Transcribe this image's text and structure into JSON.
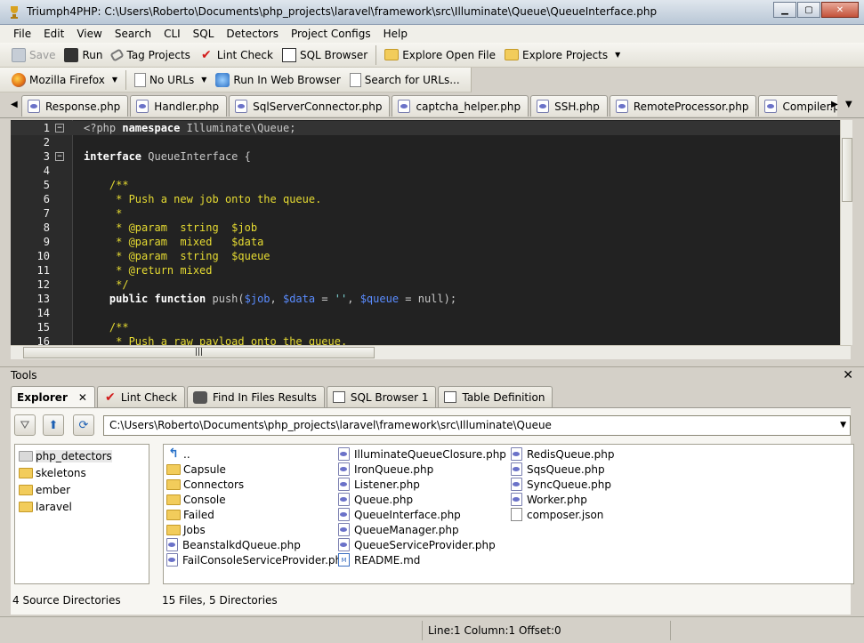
{
  "window": {
    "title": "Triumph4PHP: C:\\Users\\Roberto\\Documents\\php_projects\\laravel\\framework\\src\\Illuminate\\Queue\\QueueInterface.php"
  },
  "menu": [
    "File",
    "Edit",
    "View",
    "Search",
    "CLI",
    "SQL",
    "Detectors",
    "Project Configs",
    "Help"
  ],
  "toolbar1": {
    "save": "Save",
    "run": "Run",
    "tag_projects": "Tag Projects",
    "lint_check": "Lint Check",
    "sql_browser": "SQL Browser",
    "explore_open_file": "Explore Open File",
    "explore_projects": "Explore Projects"
  },
  "toolbar2": {
    "browser": "Mozilla Firefox",
    "urls": "No URLs",
    "run_in_browser": "Run In Web Browser",
    "search_urls": "Search for URLs..."
  },
  "editor_tabs": [
    "Response.php",
    "Handler.php",
    "SqlServerConnector.php",
    "captcha_helper.php",
    "SSH.php",
    "RemoteProcessor.php",
    "Compiler.php",
    ""
  ],
  "editor": {
    "lines": [
      {
        "n": "1",
        "fold": "−",
        "parts": [
          {
            "t": "<?php ",
            "c": "cls"
          },
          {
            "t": "namespace ",
            "c": "kw"
          },
          {
            "t": "Illuminate\\Queue;",
            "c": "cls"
          }
        ]
      },
      {
        "n": "2",
        "fold": "",
        "parts": []
      },
      {
        "n": "3",
        "fold": "−",
        "parts": [
          {
            "t": "interface ",
            "c": "kw"
          },
          {
            "t": "QueueInterface {",
            "c": "cls"
          }
        ]
      },
      {
        "n": "4",
        "fold": "",
        "parts": []
      },
      {
        "n": "5",
        "fold": "",
        "parts": [
          {
            "t": "    /**",
            "c": "cm"
          }
        ]
      },
      {
        "n": "6",
        "fold": "",
        "parts": [
          {
            "t": "     * Push a new job onto the queue.",
            "c": "cm"
          }
        ]
      },
      {
        "n": "7",
        "fold": "",
        "parts": [
          {
            "t": "     *",
            "c": "cm"
          }
        ]
      },
      {
        "n": "8",
        "fold": "",
        "parts": [
          {
            "t": "     * @param  string  $job",
            "c": "cm"
          }
        ]
      },
      {
        "n": "9",
        "fold": "",
        "parts": [
          {
            "t": "     * @param  mixed   $data",
            "c": "cm"
          }
        ]
      },
      {
        "n": "10",
        "fold": "",
        "parts": [
          {
            "t": "     * @param  string  $queue",
            "c": "cm"
          }
        ]
      },
      {
        "n": "11",
        "fold": "",
        "parts": [
          {
            "t": "     * @return mixed",
            "c": "cm"
          }
        ]
      },
      {
        "n": "12",
        "fold": "",
        "parts": [
          {
            "t": "     */",
            "c": "cm"
          }
        ]
      },
      {
        "n": "13",
        "fold": "",
        "parts": [
          {
            "t": "    public function ",
            "c": "kw"
          },
          {
            "t": "push(",
            "c": "cls"
          },
          {
            "t": "$job",
            "c": "var"
          },
          {
            "t": ", ",
            "c": "cls"
          },
          {
            "t": "$data",
            "c": "var"
          },
          {
            "t": " = ",
            "c": "cls"
          },
          {
            "t": "''",
            "c": "str"
          },
          {
            "t": ", ",
            "c": "cls"
          },
          {
            "t": "$queue",
            "c": "var"
          },
          {
            "t": " = null);",
            "c": "cls"
          }
        ]
      },
      {
        "n": "14",
        "fold": "",
        "parts": []
      },
      {
        "n": "15",
        "fold": "",
        "parts": [
          {
            "t": "    /**",
            "c": "cm"
          }
        ]
      },
      {
        "n": "16",
        "fold": "",
        "parts": [
          {
            "t": "     * Push a raw payload onto the queue.",
            "c": "cm"
          }
        ]
      }
    ]
  },
  "tools": {
    "header": "Tools",
    "close": "✕",
    "tabs": [
      "Explorer",
      "Lint Check",
      "Find In Files Results",
      "SQL Browser 1",
      "Table Definition"
    ]
  },
  "explorer": {
    "path": "C:\\Users\\Roberto\\Documents\\php_projects\\laravel\\framework\\src\\Illuminate\\Queue",
    "source_dirs": [
      "php_detectors",
      "skeletons",
      "ember",
      "laravel"
    ],
    "files_col1": [
      {
        "name": "..",
        "kind": "up"
      },
      {
        "name": "Capsule",
        "kind": "folder"
      },
      {
        "name": "Connectors",
        "kind": "folder"
      },
      {
        "name": "Console",
        "kind": "folder"
      },
      {
        "name": "Failed",
        "kind": "folder"
      },
      {
        "name": "Jobs",
        "kind": "folder"
      },
      {
        "name": "BeanstalkdQueue.php",
        "kind": "php"
      },
      {
        "name": "FailConsoleServiceProvider.php",
        "kind": "php"
      }
    ],
    "files_col2": [
      {
        "name": "IlluminateQueueClosure.php",
        "kind": "php"
      },
      {
        "name": "IronQueue.php",
        "kind": "php"
      },
      {
        "name": "Listener.php",
        "kind": "php"
      },
      {
        "name": "Queue.php",
        "kind": "php"
      },
      {
        "name": "QueueInterface.php",
        "kind": "php"
      },
      {
        "name": "QueueManager.php",
        "kind": "php"
      },
      {
        "name": "QueueServiceProvider.php",
        "kind": "php"
      },
      {
        "name": "README.md",
        "kind": "md"
      }
    ],
    "files_col3": [
      {
        "name": "RedisQueue.php",
        "kind": "php"
      },
      {
        "name": "SqsQueue.php",
        "kind": "php"
      },
      {
        "name": "SyncQueue.php",
        "kind": "php"
      },
      {
        "name": "Worker.php",
        "kind": "php"
      },
      {
        "name": "composer.json",
        "kind": "doc"
      }
    ],
    "status_left": "4 Source Directories",
    "status_right": "15 Files, 5 Directories"
  },
  "status": {
    "position": "Line:1 Column:1 Offset:0"
  }
}
